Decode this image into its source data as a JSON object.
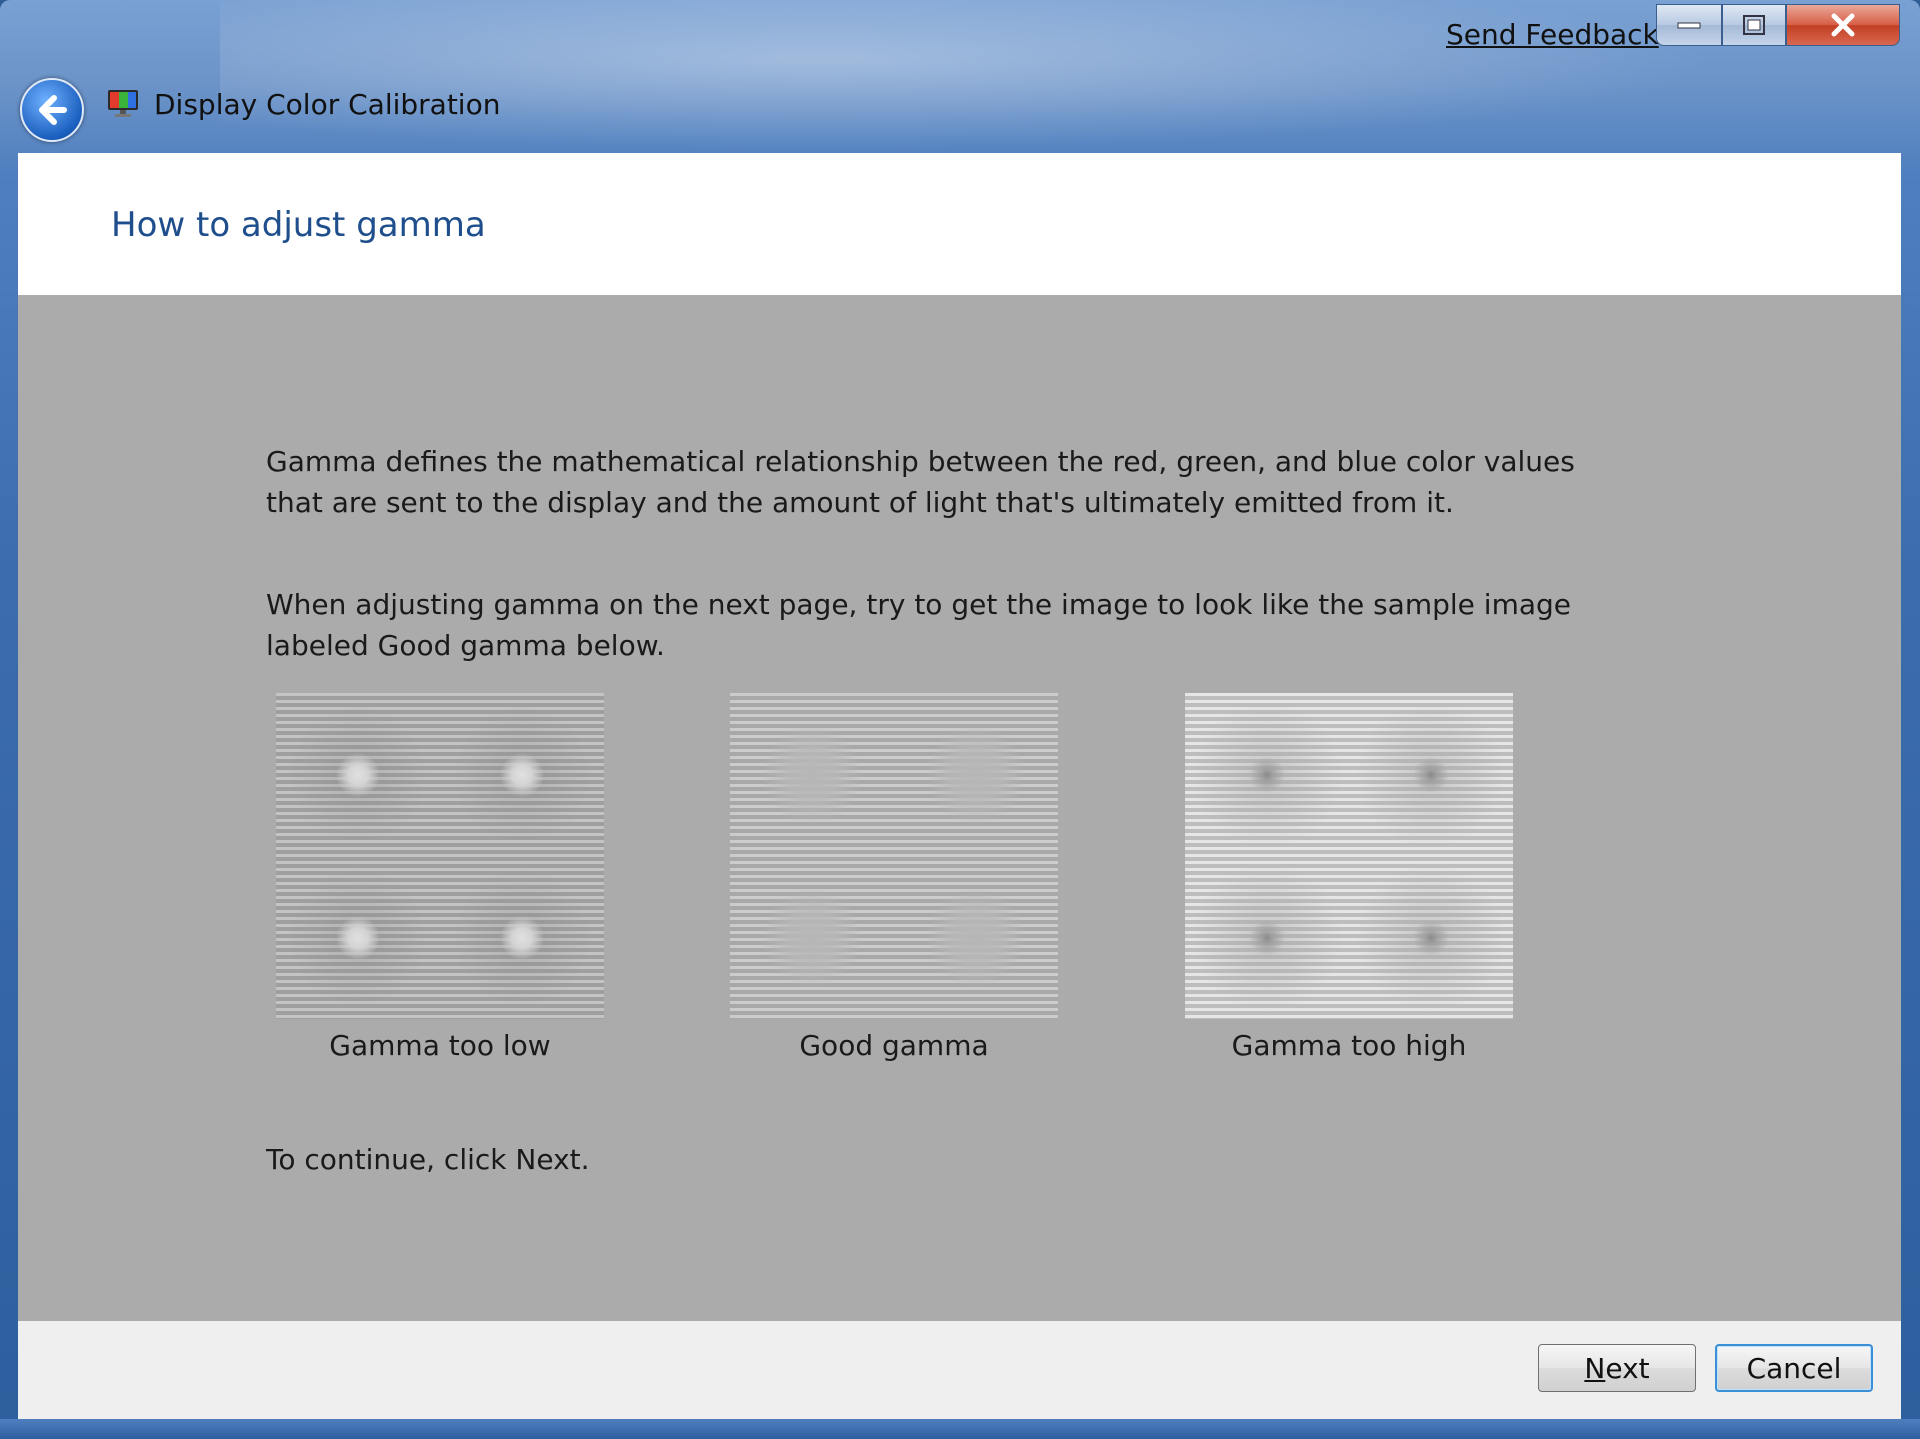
{
  "window": {
    "title": "Display Color Calibration",
    "feedback_link": "Send Feedback",
    "controls": {
      "minimize_icon": "minimize-icon",
      "maximize_icon": "maximize-icon",
      "close_icon": "close-icon"
    },
    "back_icon": "back-arrow-icon",
    "app_icon": "display-color-calibration-icon"
  },
  "header": {
    "title": "How to adjust gamma"
  },
  "body": {
    "paragraph_1": "Gamma defines the mathematical relationship between the red, green, and blue color values that are sent to the display and the amount of light that's ultimately emitted from it.",
    "paragraph_2": "When adjusting gamma on the next page, try to get the image to look like the sample image labeled Good gamma below.",
    "samples": [
      {
        "label": "Gamma too low"
      },
      {
        "label": "Good gamma"
      },
      {
        "label": "Gamma too high"
      }
    ],
    "instruction": "To continue, click Next."
  },
  "footer": {
    "next_label_first": "N",
    "next_label_rest": "ext",
    "cancel_label": "Cancel"
  },
  "colors": {
    "content_bg": "#ababab",
    "header_title": "#1e4e8c",
    "footer_bg": "#efefef",
    "chrome_blue": "#3c6cac"
  }
}
